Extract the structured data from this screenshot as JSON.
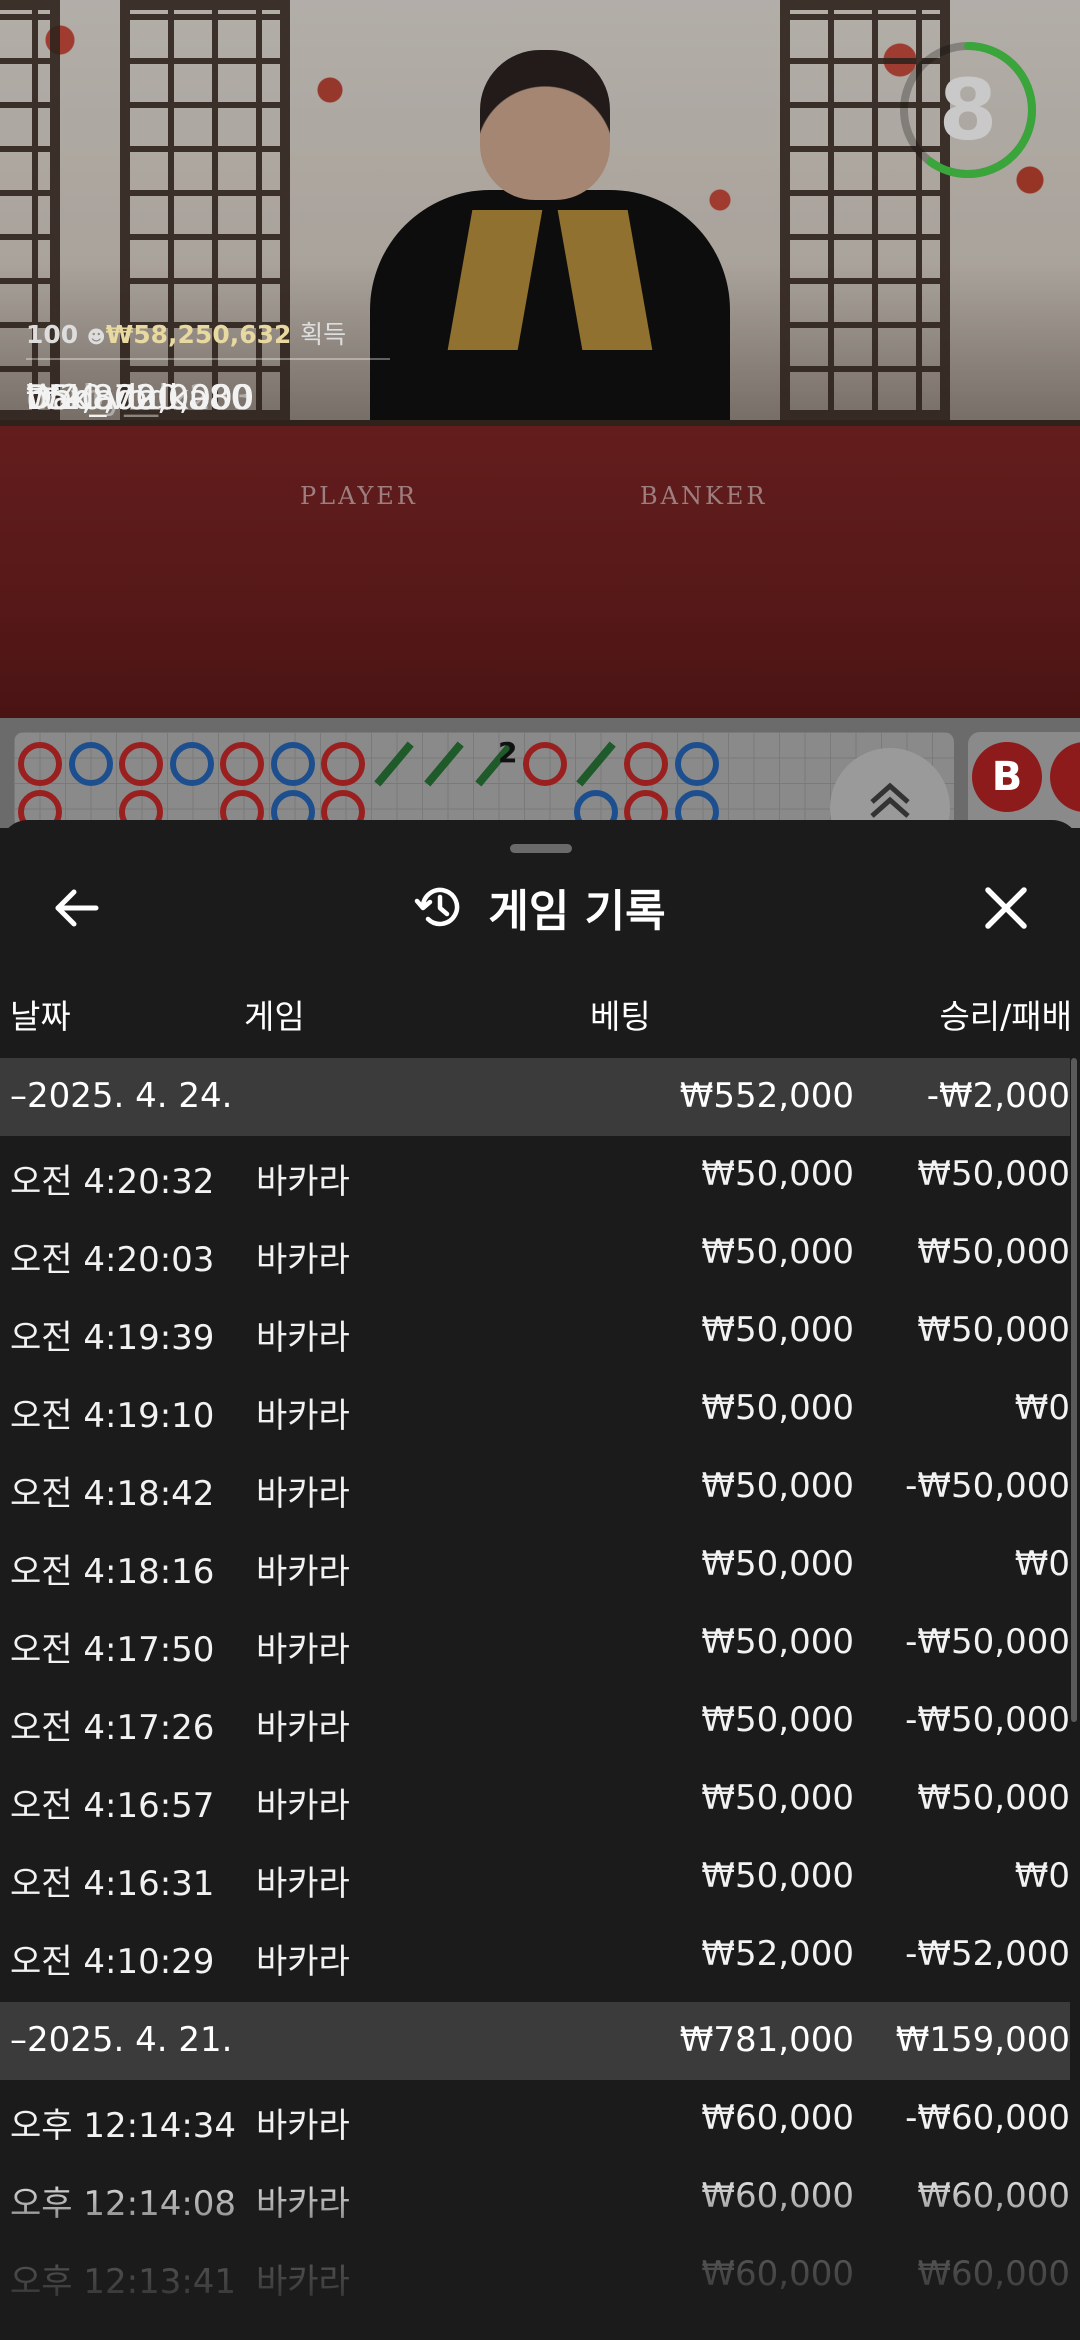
{
  "video": {
    "timer": "8",
    "table_labels": [
      "PLAYER",
      "BANKER"
    ],
    "winners": {
      "count": "100",
      "total": "₩58,250,632",
      "total_label": "획득",
      "rows": [
        {
          "amount": "₩40,000,000",
          "name": "Dadada"
        },
        {
          "amount": "₩2,872,000",
          "name": "b5x_vodka80"
        },
        {
          "amount": "₩2,000,000",
          "name": "derby__l2233"
        }
      ]
    }
  },
  "roadmap": {
    "marker_number": "2",
    "b_badge": "B"
  },
  "sheet": {
    "title": "게임 기록",
    "columns": {
      "date": "날짜",
      "game": "게임",
      "bet": "베팅",
      "result": "승리/패배"
    },
    "groups": [
      {
        "date": "–2025. 4. 24.",
        "total_bet": "₩552,000",
        "total_result": "-₩2,000",
        "rows": [
          {
            "time": "오전 4:20:32",
            "game": "바카라",
            "bet": "₩50,000",
            "result": "₩50,000"
          },
          {
            "time": "오전 4:20:03",
            "game": "바카라",
            "bet": "₩50,000",
            "result": "₩50,000"
          },
          {
            "time": "오전 4:19:39",
            "game": "바카라",
            "bet": "₩50,000",
            "result": "₩50,000"
          },
          {
            "time": "오전 4:19:10",
            "game": "바카라",
            "bet": "₩50,000",
            "result": "₩0"
          },
          {
            "time": "오전 4:18:42",
            "game": "바카라",
            "bet": "₩50,000",
            "result": "-₩50,000"
          },
          {
            "time": "오전 4:18:16",
            "game": "바카라",
            "bet": "₩50,000",
            "result": "₩0"
          },
          {
            "time": "오전 4:17:50",
            "game": "바카라",
            "bet": "₩50,000",
            "result": "-₩50,000"
          },
          {
            "time": "오전 4:17:26",
            "game": "바카라",
            "bet": "₩50,000",
            "result": "-₩50,000"
          },
          {
            "time": "오전 4:16:57",
            "game": "바카라",
            "bet": "₩50,000",
            "result": "₩50,000"
          },
          {
            "time": "오전 4:16:31",
            "game": "바카라",
            "bet": "₩50,000",
            "result": "₩0"
          },
          {
            "time": "오전 4:10:29",
            "game": "바카라",
            "bet": "₩52,000",
            "result": "-₩52,000"
          }
        ]
      },
      {
        "date": "–2025. 4. 21.",
        "total_bet": "₩781,000",
        "total_result": "₩159,000",
        "rows": [
          {
            "time": "오후 12:14:34",
            "game": "바카라",
            "bet": "₩60,000",
            "result": "-₩60,000"
          },
          {
            "time": "오후 12:14:08",
            "game": "바카라",
            "bet": "₩60,000",
            "result": "₩60,000"
          },
          {
            "time": "오후 12:13:41",
            "game": "바카라",
            "bet": "₩60,000",
            "result": "₩60,000"
          }
        ]
      }
    ]
  },
  "icons": {
    "back": "arrow-left-icon",
    "history": "history-icon",
    "close": "close-icon",
    "expand": "chevron-double-up-icon"
  },
  "colors": {
    "sheet_bg": "#1b1b1b",
    "group_bg": "#3b3b3b",
    "timer_green": "#3aa53a",
    "banker_red": "#8e1b1b",
    "player_blue": "#1d4f8f"
  }
}
